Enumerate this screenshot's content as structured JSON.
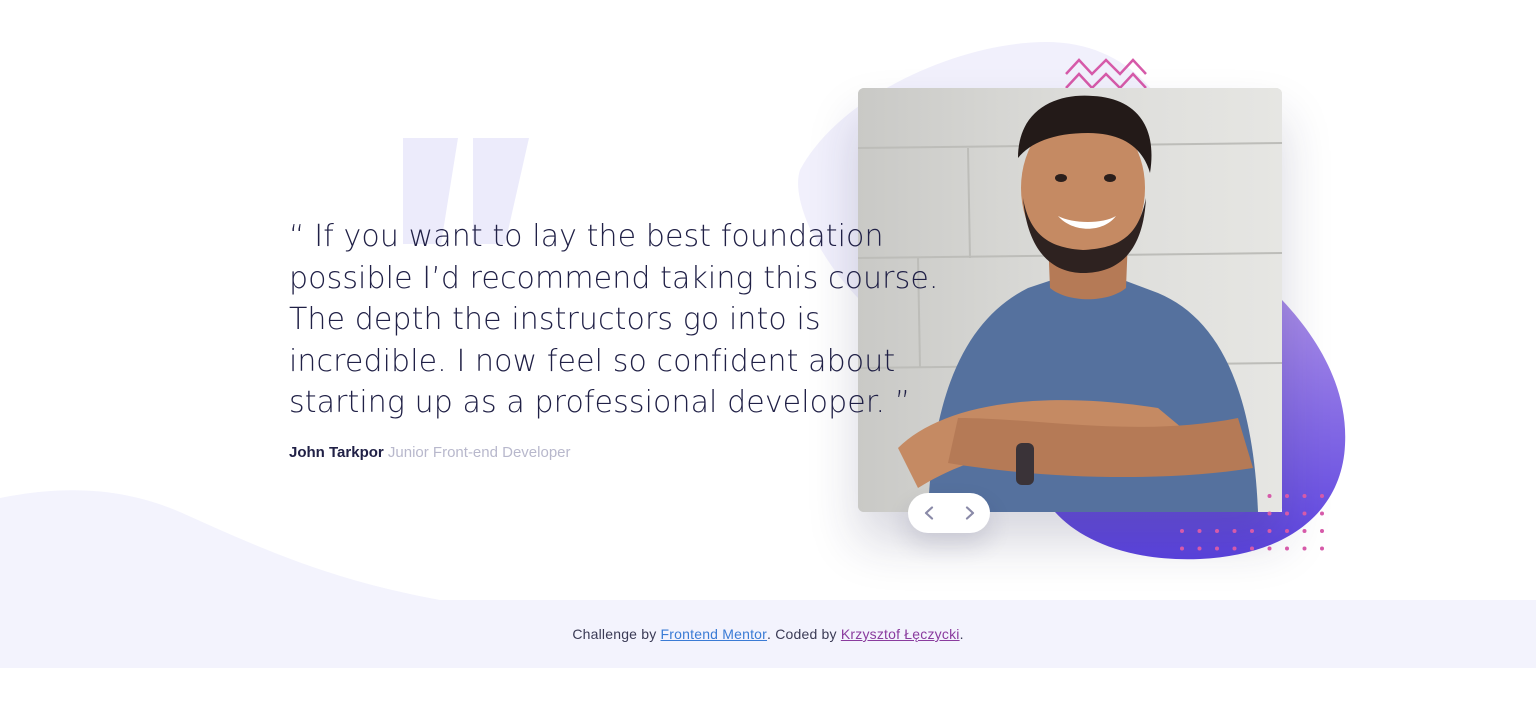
{
  "testimonial": {
    "quote": "“ If you want to lay the best foundation possible I’d recommend taking this course. The depth the instructors go into is incredible. I now feel so confident about starting up as a professional developer. ”",
    "author_name": "John Tarkpor",
    "author_role": "Junior Front-end Developer"
  },
  "slider": {
    "prev_icon": "chevron-left-icon",
    "next_icon": "chevron-right-icon"
  },
  "footer": {
    "prefix": "Challenge by ",
    "link1": "Frontend Mentor",
    "middle": ". Coded by ",
    "link2": "Krzysztof Łęczycki",
    "suffix": "."
  },
  "colors": {
    "text_dark": "#202046",
    "text_muted": "#b8b8cc",
    "accent_purple": "#6a4de0",
    "accent_pink": "#d65aa9",
    "pale_bg": "#f3f3fd",
    "link_blue": "#3a7bd5",
    "link_purple": "#8a3b9e"
  }
}
